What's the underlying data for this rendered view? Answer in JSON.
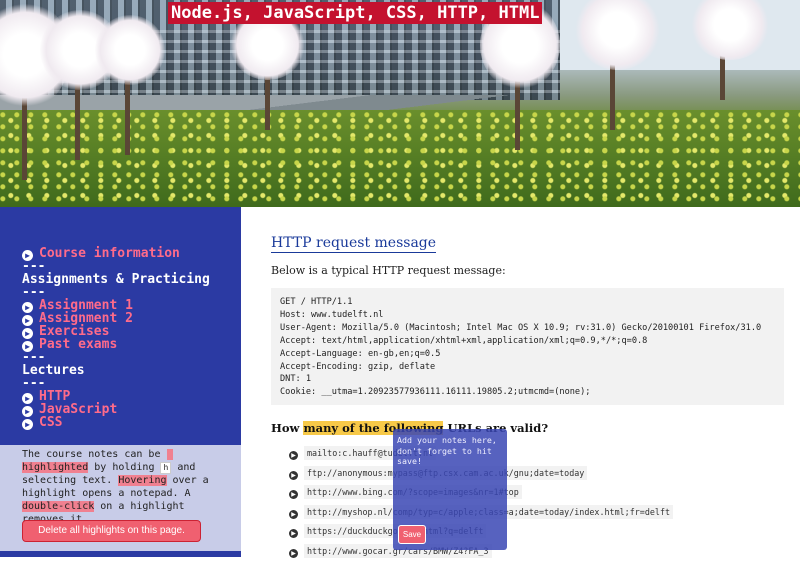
{
  "banner": {
    "title": "Node.js, JavaScript, CSS, HTTP, HTML"
  },
  "sidebar": {
    "nav": [
      {
        "type": "link",
        "label": "Course information"
      },
      {
        "type": "sep",
        "label": "---"
      },
      {
        "type": "head",
        "label": "Assignments & Practicing"
      },
      {
        "type": "sep",
        "label": "---"
      },
      {
        "type": "link",
        "label": "Assignment 1"
      },
      {
        "type": "link",
        "label": "Assignment 2"
      },
      {
        "type": "link",
        "label": "Exercises"
      },
      {
        "type": "link",
        "label": "Past exams"
      },
      {
        "type": "sep",
        "label": "---"
      },
      {
        "type": "head",
        "label": "Lectures"
      },
      {
        "type": "sep",
        "label": "---"
      },
      {
        "type": "link",
        "label": "HTTP"
      },
      {
        "type": "link",
        "label": "JavaScript"
      },
      {
        "type": "link",
        "label": "CSS"
      }
    ],
    "notes": {
      "t1": "The course notes can be ",
      "hl1": "highlighted",
      "t2": " by holding ",
      "key": "h",
      "t3": " and selecting text. ",
      "hl2": "Hovering",
      "t4": " over a highlight opens a notepad. A ",
      "hl3": "double-click",
      "t5": " on a highlight removes it.",
      "delete_label": "Delete all highlights on this page."
    }
  },
  "main": {
    "section_title": "HTTP request message",
    "intro": "Below is a typical HTTP request message:",
    "code_lines": [
      "GET / HTTP/1.1",
      "Host: www.tudelft.nl",
      "User-Agent: Mozilla/5.0 (Macintosh; Intel Mac OS X 10.9; rv:31.0) Gecko/20100101 Firefox/31.0",
      "Accept: text/html,application/xhtml+xml,application/xml;q=0.9,*/*;q=0.8",
      "Accept-Language: en-gb,en;q=0.5",
      "Accept-Encoding: gzip, deflate",
      "DNT: 1",
      "Cookie: __utma=1.20923577936111.16111.19805.2;utmcmd=(none);"
    ],
    "question_pre": "How ",
    "question_hl": "many of the following",
    "question_post": " URLs are valid?",
    "urls": [
      "mailto:c.hauff@tudelft.nl",
      "ftp://anonymous:mypass@ftp.csx.cam.ac.uk/gnu;date=today",
      "http://www.bing.com/?scope=images&nr=1#top",
      "http://myshop.nl/comp/typ=c/apple;class=a;date=today/index.html;fr=delft",
      "https://duckduckgo.com/html?q=delft",
      "http://www.gocar.gr/cars/BMW/Z4?FA_3"
    ]
  },
  "note_popup": {
    "text": "Add your notes here, don't forget to hit save!",
    "save_label": "Save"
  },
  "colors": {
    "banner_title_bg": "#c4122f",
    "sidebar_bg": "#2b3aa3",
    "nav_link": "#ff6b8a",
    "notes_bg": "#c8cce8",
    "highlight": "#f08090",
    "question_highlight": "#f7c948",
    "popup_bg": "#3a46b4"
  }
}
